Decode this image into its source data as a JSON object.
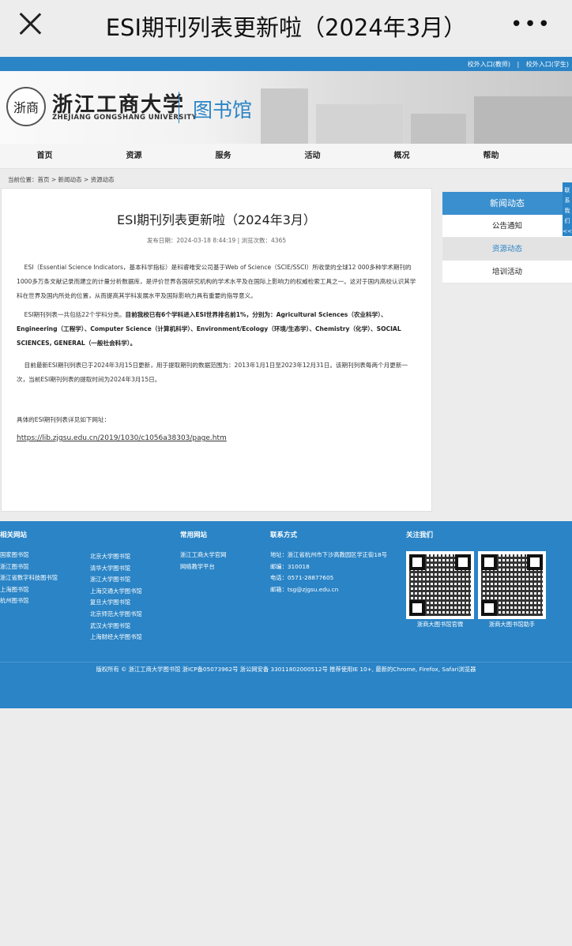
{
  "appbar": {
    "title": "ESI期刊列表更新啦（2024年3月）",
    "more": "•••"
  },
  "topbar": {
    "links": [
      "校外入口(教师)",
      "|",
      "校外入口(学生)"
    ]
  },
  "brand": {
    "seal_text": "浙商",
    "name_cn": "浙江工商大学",
    "name_en": "ZHEJIANG GONGSHANG UNIVERSITY",
    "library": "图书馆"
  },
  "nav": [
    "首页",
    "资源",
    "服务",
    "活动",
    "概况",
    "帮助"
  ],
  "breadcrumb": "当前位置：首页 > 新闻动态 > 资源动态",
  "article": {
    "title": "ESI期刊列表更新啦（2024年3月）",
    "meta": "发布日期：2024-03-18 8:44:19 | 浏览次数：4365",
    "p1": "ESI（Essential Science Indicators，基本科学指标）是科睿唯安公司基于Web of Science（SCIE/SSCI）所收录的全球12 000多种学术期刊的1000多万条文献记录而建立的计量分析数据库，是评价世界各国研究机构的学术水平及在国际上影响力的权威检索工具之一。这对于国内高校认识其学科在世界及国内所处的位置，从而提高其学科发展水平及国际影响力具有重要的指导意义。",
    "p2_plain": "ESI期刊列表一共包括22个学科分类。",
    "p2_bold": "目前我校已有6个学科进入ESI世界排名前1%，分别为：Agricultural Sciences（农业科学）、Engineering（工程学）、Computer Science（计算机科学）、Environment/Ecology（环境/生态学）、Chemistry（化学）、SOCIAL SCIENCES, GENERAL（一般社会科学）。",
    "p3": "目前最新ESI期刊列表已于2024年3月15日更新，用于提取期刊的数据范围为：2013年1月1日至2023年12月31日。该期刊列表每两个月更新一次，当前ESI期刊列表的提取时间为2024年3月15日。",
    "p4": "具体的ESI期刊列表详见如下网址：",
    "link": "https://lib.zjgsu.edu.cn/2019/1030/c1056a38303/page.htm"
  },
  "sidebar": {
    "header": "新闻动态",
    "items": [
      "公告通知",
      "资源动态",
      "培训活动"
    ],
    "active_index": 1,
    "float_tab": "联系我们<<"
  },
  "footer": {
    "related_title": "相关网站",
    "related_col1": [
      "国家图书馆",
      "浙江图书馆",
      "浙江省数字科技图书馆",
      "上海图书馆",
      "杭州图书馆"
    ],
    "related_col2": [
      "北京大学图书馆",
      "清华大学图书馆",
      "浙江大学图书馆",
      "上海交通大学图书馆",
      "复旦大学图书馆",
      "北京师范大学图书馆",
      "武汉大学图书馆",
      "上海财经大学图书馆"
    ],
    "common_title": "常用网站",
    "common_links": [
      "浙江工商大学官网",
      "网络教学平台"
    ],
    "contact_title": "联系方式",
    "contact": [
      "地址：浙江省杭州市下沙高教园区学正街18号",
      "邮编：310018",
      "电话：0571-28877605",
      "邮箱：tsg@zjgsu.edu.cn"
    ],
    "follow_title": "关注我们",
    "qr_captions": [
      "浙商大图书馆官微",
      "浙商大图书馆助手"
    ],
    "copyright": "版权所有 © 浙江工商大学图书馆    浙ICP备05073962号    浙公网安备 33011802000512号    推荐使用IE 10+, 最新的Chrome, Firefox, Safari浏览器"
  },
  "colors": {
    "accent": "#2a84c6",
    "page_bg": "#ececec"
  }
}
